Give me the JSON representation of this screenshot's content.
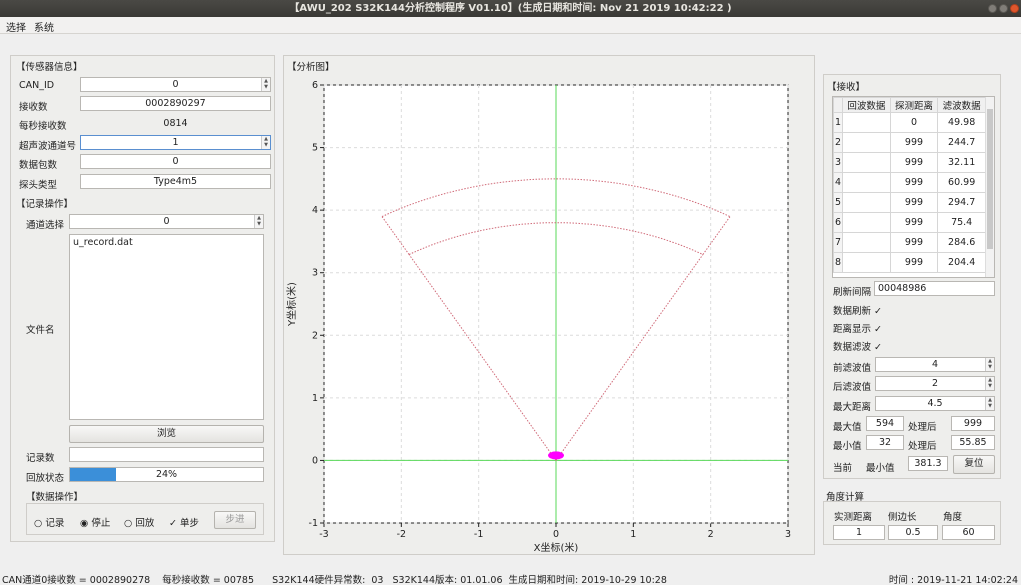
{
  "window": {
    "title": "【AWU_202 S32K144分析控制程序 V01.10】(生成日期和时间: Nov 21 2019 10:42:22 )"
  },
  "menu": [
    "选择",
    "系统"
  ],
  "sensor": {
    "group_title": "【传感器信息】",
    "can_id": {
      "label": "CAN_ID",
      "value": "0"
    },
    "recv_count": {
      "label": "接收数",
      "value": "0002890297"
    },
    "per_sec": {
      "label": "每秒接收数",
      "value": "0814"
    },
    "channel": {
      "label": "超声波通道号",
      "value": "1"
    },
    "packets": {
      "label": "数据包数",
      "value": "0"
    },
    "probe_type": {
      "label": "探头类型",
      "value": "Type4m5"
    }
  },
  "record": {
    "group_title": "【记录操作】",
    "channel_select": {
      "label": "通道选择",
      "value": "0"
    },
    "filename_label": "文件名",
    "filename_value": "u_record.dat",
    "browse": "浏览",
    "record_count_label": "记录数",
    "record_count_value": "",
    "playback_label": "回放状态",
    "playback_text": "24%",
    "playback_progress": 0.24
  },
  "data_ops": {
    "group_title": "【数据操作】",
    "record": "记录",
    "stop": "停止",
    "playback": "回放",
    "single_step": "单步",
    "step": "步进",
    "selected": "stop",
    "single_step_checked": true
  },
  "chart_title": "【分析图】",
  "chart_data": {
    "type": "scatter",
    "xlabel": "X坐标(米)",
    "ylabel": "Y坐标(米)",
    "xlim": [
      -3,
      3
    ],
    "ylim": [
      -1,
      6
    ],
    "xticks": [
      "-3",
      "-2",
      "-1",
      "0",
      "1",
      "2",
      "3"
    ],
    "yticks": [
      "-1",
      "0",
      "1",
      "2",
      "3",
      "4",
      "5",
      "6"
    ],
    "grid": true,
    "sector": {
      "half_angle_deg": 30,
      "inner_radius": 3.8,
      "outer_radius": 4.5
    },
    "point": {
      "x": 0,
      "y": 0.08
    },
    "colors": {
      "axes_lines": "#58d858",
      "sector": "#d06a78",
      "point": "#ff00ff"
    }
  },
  "receive": {
    "group_title": "【接收】",
    "columns": [
      "回波数据",
      "探测距离",
      "滤波数据"
    ],
    "rows": [
      {
        "idx": "1",
        "echo": "",
        "dist": "0",
        "filt": "49.98"
      },
      {
        "idx": "2",
        "echo": "",
        "dist": "999",
        "filt": "244.7"
      },
      {
        "idx": "3",
        "echo": "",
        "dist": "999",
        "filt": "32.11"
      },
      {
        "idx": "4",
        "echo": "",
        "dist": "999",
        "filt": "60.99"
      },
      {
        "idx": "5",
        "echo": "",
        "dist": "999",
        "filt": "294.7"
      },
      {
        "idx": "6",
        "echo": "",
        "dist": "999",
        "filt": "75.4"
      },
      {
        "idx": "7",
        "echo": "",
        "dist": "999",
        "filt": "284.6"
      },
      {
        "idx": "8",
        "echo": "",
        "dist": "999",
        "filt": "204.4"
      }
    ],
    "refresh_interval": {
      "label": "刷新间隔",
      "value": "00048986"
    },
    "data_refresh": "数据刷新",
    "distance_display": "距离显示",
    "data_filter": "数据滤波",
    "pre_filter": {
      "label": "前滤波值",
      "value": "4"
    },
    "post_filter": {
      "label": "后滤波值",
      "value": "2"
    },
    "max_distance": {
      "label": "最大距离",
      "value": "4.5"
    },
    "max_value": {
      "label": "最大值",
      "value": "594",
      "after_label": "处理后",
      "after": "999"
    },
    "min_value": {
      "label": "最小值",
      "value": "32",
      "after_label": "处理后",
      "after": "55.85"
    },
    "current_min": {
      "label": "当前",
      "sub_label": "最小值",
      "value": "381.3"
    },
    "reset": "复位"
  },
  "angle": {
    "group_title": "角度计算",
    "headers": [
      "实测距离",
      "侧边长",
      "角度"
    ],
    "values": [
      "1",
      "0.5",
      "60"
    ]
  },
  "status": {
    "left": "CAN通道0接收数 = 0002890278    每秒接收数 = 00785      S32K144硬件异常数:  03   S32K144版本: 01.01.06  生成日期和时间: 2019-10-29 10:28",
    "right": "时间 : 2019-11-21 14:02:24"
  }
}
